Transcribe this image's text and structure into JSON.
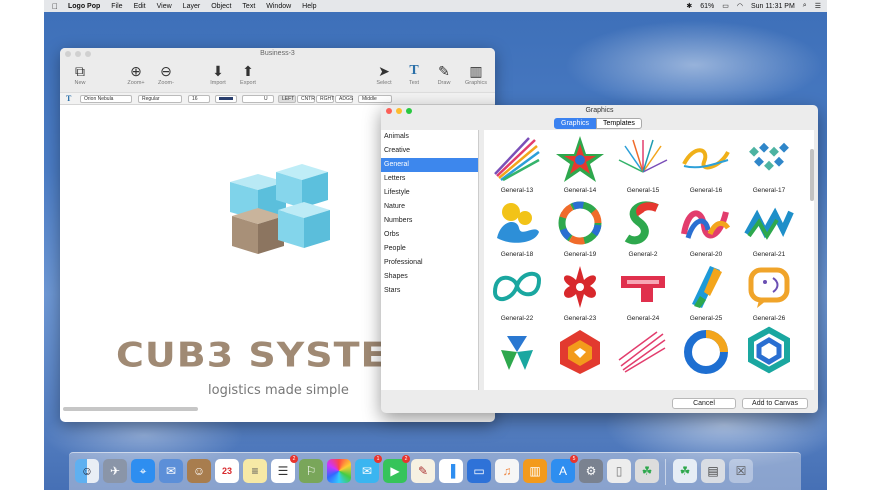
{
  "menubar": {
    "app": "Logo Pop",
    "items": [
      "File",
      "Edit",
      "View",
      "Layer",
      "Object",
      "Text",
      "Window",
      "Help"
    ],
    "battery": "61%",
    "clock": "Sun 11:31 PM"
  },
  "main_window": {
    "title": "Business-3",
    "toolbar": {
      "new": "New",
      "zoom_in": "Zoom+",
      "zoom_out": "Zoom-",
      "import": "Import",
      "export": "Export",
      "select": "Select",
      "text": "Text",
      "draw": "Draw",
      "graphics": "Graphics"
    },
    "format": {
      "font": "Orion Nebula",
      "style": "Regular",
      "size": "16",
      "underline": "U",
      "align_left": "LEFT",
      "align_center": "CNTR",
      "align_right": "RGHT",
      "align_justify": "ADGS",
      "vertical": "Middle"
    },
    "logo_text": "CUB3 SYSTE",
    "logo_subtitle": "logistics made simple"
  },
  "graphics_panel": {
    "title": "Graphics",
    "tabs": [
      "Graphics",
      "Templates"
    ],
    "categories": [
      "Animals",
      "Creative",
      "General",
      "Letters",
      "Lifestyle",
      "Nature",
      "Numbers",
      "Orbs",
      "People",
      "Professional",
      "Shapes",
      "Stars"
    ],
    "selected_category": "General",
    "tiles": [
      "General-13",
      "General-14",
      "General-15",
      "General-16",
      "General-17",
      "General-18",
      "General-19",
      "General-2",
      "General-20",
      "General-21",
      "General-22",
      "General-23",
      "General-24",
      "General-25",
      "General-26",
      "",
      "",
      "",
      "",
      ""
    ],
    "cancel": "Cancel",
    "add": "Add to Canvas"
  },
  "dock": {
    "badges": {
      "reminders": "2",
      "messages": "1",
      "facetime": "2",
      "appstore": "5"
    },
    "calendar_day": "23"
  },
  "colors": {
    "accent": "#3d87ed",
    "logo_brown": "#a08a74",
    "cube_blue": "#7fd3ea"
  }
}
